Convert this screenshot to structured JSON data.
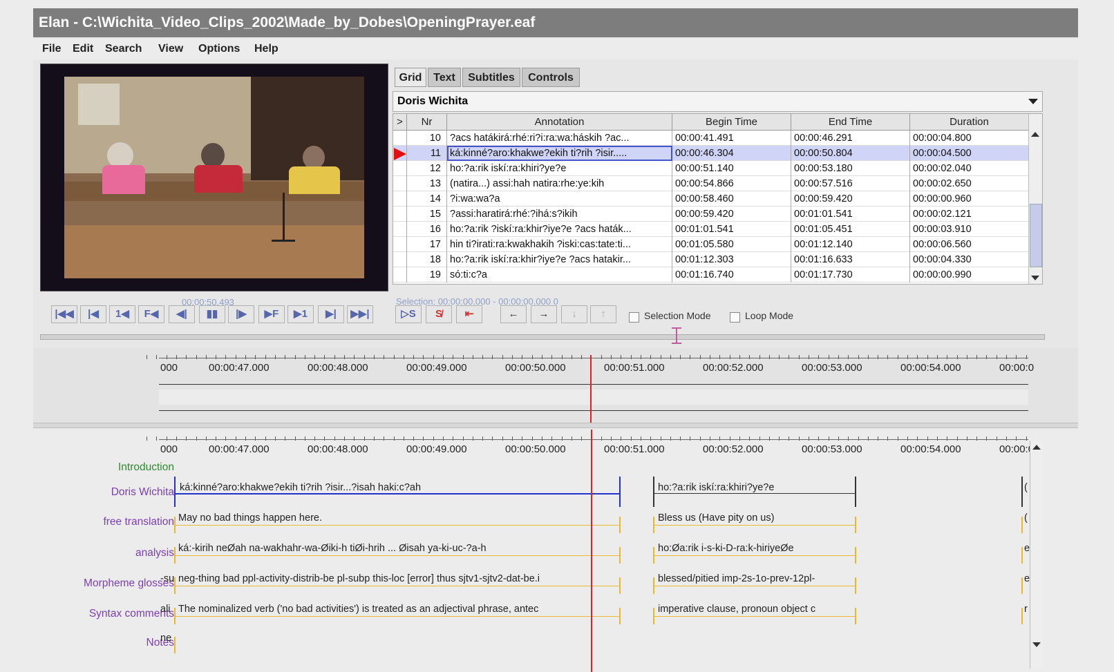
{
  "window": {
    "title": "Elan - C:\\Wichita_Video_Clips_2002\\Made_by_Dobes\\OpeningPrayer.eaf"
  },
  "menu": [
    "File",
    "Edit",
    "Search",
    "View",
    "Options",
    "Help"
  ],
  "video": {
    "current_time": "00:00:50.493"
  },
  "tabs": [
    {
      "label": "Grid",
      "selected": true
    },
    {
      "label": "Text",
      "selected": false
    },
    {
      "label": "Subtitles",
      "selected": false
    },
    {
      "label": "Controls",
      "selected": false
    }
  ],
  "grid": {
    "tier": "Doris Wichita",
    "headers": {
      "marker": ">",
      "nr": "Nr",
      "annotation": "Annotation",
      "begin": "Begin Time",
      "end": "End Time",
      "duration": "Duration"
    },
    "selected_nr": "11",
    "rows": [
      {
        "nr": "10",
        "annotation": "?acs hatákirá:rhé:ri?i:ra:wa:háskih ?ac...",
        "begin": "00:00:41.491",
        "end": "00:00:46.291",
        "duration": "00:00:04.800"
      },
      {
        "nr": "11",
        "annotation": "ká:kinné?aro:khakwe?ekih ti?rih ?isir.....",
        "begin": "00:00:46.304",
        "end": "00:00:50.804",
        "duration": "00:00:04.500"
      },
      {
        "nr": "12",
        "annotation": "ho:?a:rik iskí:ra:khiri?ye?e",
        "begin": "00:00:51.140",
        "end": "00:00:53.180",
        "duration": "00:00:02.040"
      },
      {
        "nr": "13",
        "annotation": "(natira...) assi:hah natira:rhe:ye:kih",
        "begin": "00:00:54.866",
        "end": "00:00:57.516",
        "duration": "00:00:02.650"
      },
      {
        "nr": "14",
        "annotation": "?i:wa:wa?a",
        "begin": "00:00:58.460",
        "end": "00:00:59.420",
        "duration": "00:00:00.960"
      },
      {
        "nr": "15",
        "annotation": "?assi:haratirá:rhé:?ihá:s?ikih",
        "begin": "00:00:59.420",
        "end": "00:01:01.541",
        "duration": "00:00:02.121"
      },
      {
        "nr": "16",
        "annotation": "ho:?a:rik ?iskí:ra:khir?iye?e ?acs haták...",
        "begin": "00:01:01.541",
        "end": "00:01:05.451",
        "duration": "00:00:03.910"
      },
      {
        "nr": "17",
        "annotation": "hin ti?irati:ra:kwakhakih ?iski:cas:tate:ti...",
        "begin": "00:01:05.580",
        "end": "00:01:12.140",
        "duration": "00:00:06.560"
      },
      {
        "nr": "18",
        "annotation": "ho:?a:rik iskí:ra:khir?iye?e ?acs hatakir...",
        "begin": "00:01:12.303",
        "end": "00:01:16.633",
        "duration": "00:00:04.330"
      },
      {
        "nr": "19",
        "annotation": "só:ti:c?a",
        "begin": "00:01:16.740",
        "end": "00:01:17.730",
        "duration": "00:00:00.990"
      }
    ]
  },
  "selection_info": "Selection: 00:00:00.000 - 00:00:00.000  0",
  "controls": {
    "buttons": [
      "|◀◀",
      "|◀",
      "1◀",
      "F◀",
      "◀|",
      "▮▮",
      "|▶",
      "▶F",
      "▶1",
      "▶|",
      "▶▶|"
    ],
    "sel_buttons": [
      "▷S",
      "S̸",
      "⇤"
    ],
    "nav_buttons": [
      "←",
      "→",
      "↓",
      "↑"
    ],
    "selection_mode": "Selection Mode",
    "loop_mode": "Loop Mode"
  },
  "ruler_labels": [
    "000",
    "00:00:47.000",
    "00:00:48.000",
    "00:00:49.000",
    "00:00:50.000",
    "00:00:51.000",
    "00:00:52.000",
    "00:00:53.000",
    "00:00:54.000",
    "00:00:0"
  ],
  "tiers": [
    {
      "name": "Introduction",
      "color": "#2e8b2e"
    },
    {
      "name": "Doris Wichita",
      "color": "#7a3fb0"
    },
    {
      "name": "free translation",
      "color": "#7a3fb0"
    },
    {
      "name": "analysis",
      "color": "#7a3fb0"
    },
    {
      "name": "Morpheme glosses",
      "color": "#7a3fb0"
    },
    {
      "name": "Syntax comments",
      "color": "#7a3fb0"
    },
    {
      "name": "Notes",
      "color": "#7a3fb0"
    }
  ],
  "timeline_annotations": {
    "doris_1": "ká:kinné?aro:khakwe?ekih ti?rih ?isir...?isah haki:c?ah",
    "doris_2": "ho:?a:rik iskí:ra:khiri?ye?e",
    "translation_1": "May no bad things happen here.",
    "translation_2": "Bless us (Have pity on us)",
    "analysis_1": "ká:-kirih neØah na-wakhahr-wa-Øiki-h tiØi-hrih ... Øisah ya-ki-uc-?a-h",
    "analysis_2": "ho:Øa:rik i-s-ki-D-ra:k-hiriyeØe",
    "gloss_pre": "-su",
    "gloss_1": "neg-thing bad ppl-activity-distrib-be pl-subp this-loc [error] thus sjtv1-sjtv2-dat-be.i",
    "gloss_2": "blessed/pitied  imp-2s-1o-prev-12pl-",
    "syntax_pre": "ali",
    "syntax_1": "The nominalized verb ('no bad activities') is treated as an adjectival phrase, antec",
    "syntax_2": "imperative clause, pronoun object c",
    "notes_pre": "ne",
    "edge_c": "(",
    "edge_e": "e",
    "edge_r": "r"
  },
  "colors": {
    "titlebar": "#7d7d7d",
    "selected_row": "#d0d4f6",
    "active_annotation": "#2233cc",
    "dependent_bar": "#e8b830",
    "crosshair": "#dd2222",
    "intro_label": "#2e8b2e",
    "tier_label": "#7a3fb0"
  }
}
